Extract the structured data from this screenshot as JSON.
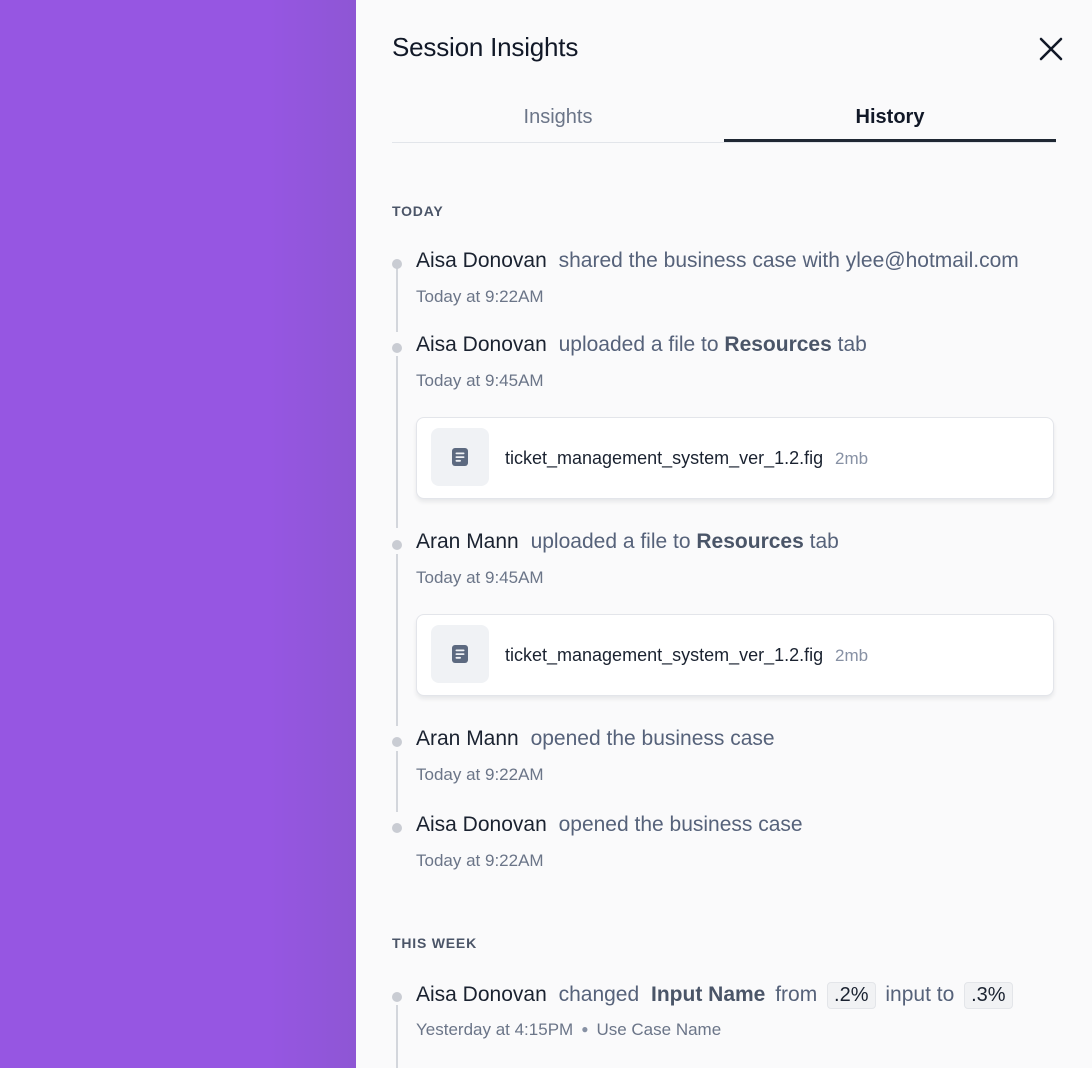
{
  "panel": {
    "title": "Session Insights",
    "close_icon": "close-icon"
  },
  "tabs": [
    {
      "label": "Insights",
      "active": false
    },
    {
      "label": "History",
      "active": true
    }
  ],
  "sections": {
    "today": "TODAY",
    "this_week": "THIS WEEK"
  },
  "entries": [
    {
      "actor": "Aisa Donovan",
      "action": "shared the business case with ylee@hotmail.com",
      "time": "Today at 9:22AM"
    },
    {
      "actor": "Aisa Donovan",
      "action_pre": "uploaded a file to",
      "action_strong": "Resources",
      "action_post": "tab",
      "time": "Today at 9:45AM",
      "file": {
        "name": "ticket_management_system_ver_1.2.fig",
        "size": "2mb",
        "icon": "document-icon"
      }
    },
    {
      "actor": "Aran Mann",
      "action_pre": "uploaded a file to",
      "action_strong": "Resources",
      "action_post": "tab",
      "time": "Today at 9:45AM",
      "file": {
        "name": "ticket_management_system_ver_1.2.fig",
        "size": "2mb",
        "icon": "document-icon"
      }
    },
    {
      "actor": "Aran Mann",
      "action": "opened the business case",
      "time": "Today at 9:22AM"
    },
    {
      "actor": "Aisa Donovan",
      "action": "opened the business case",
      "time": "Today at 9:22AM"
    }
  ],
  "week_entries": [
    {
      "actor": "Aisa Donovan",
      "action_pre": "changed",
      "field": "Input Name",
      "from_word": "from",
      "from_value": ".2%",
      "to_word": "input to",
      "to_value": ".3%",
      "time": "Yesterday at 4:15PM",
      "context": "Use Case Name"
    }
  ],
  "colors": {
    "backdrop": "#9656e2",
    "panel_bg": "#fafafb",
    "active_tab_underline": "#1f2733"
  }
}
